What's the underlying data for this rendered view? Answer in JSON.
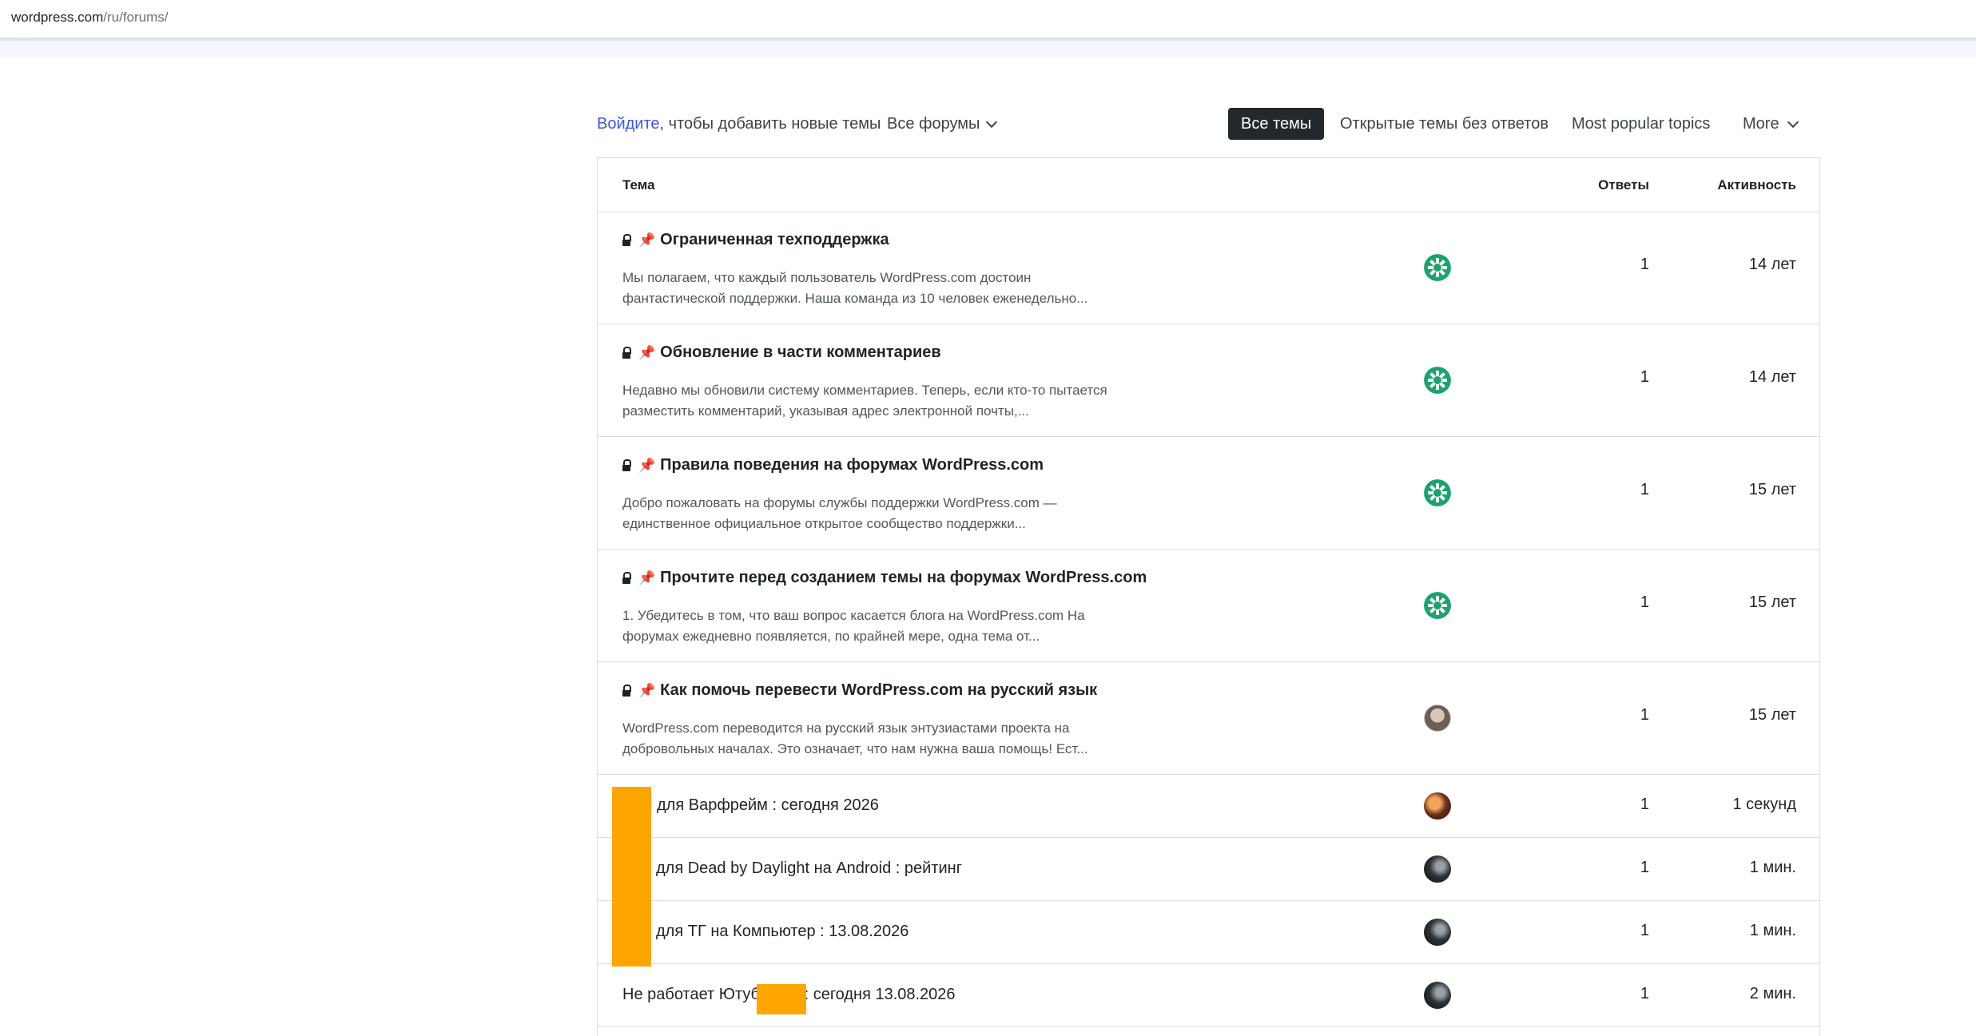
{
  "browser": {
    "url_host": "wordpress.com",
    "url_path": "/ru/forums/"
  },
  "toolbar": {
    "login_link": "Войдите",
    "login_rest": ", чтобы добавить новые темы",
    "forums_select": "Все форумы",
    "tabs": {
      "all": "Все темы",
      "open": "Открытые темы без ответов",
      "popular": "Most popular topics",
      "more": "More"
    }
  },
  "table": {
    "headers": {
      "topic": "Тема",
      "replies": "Ответы",
      "activity": "Активность"
    },
    "rows": [
      {
        "title": "Ограниченная техподдержка",
        "excerpt": "Мы полагаем, что каждый пользователь WordPress.com достоин фантастической поддержки. Наша команда из 10 человек еженедельно...",
        "avatar": "green-pattern-avatar",
        "replies": "1",
        "activity": "14 лет"
      },
      {
        "title": "Обновление в части комментариев",
        "excerpt": "Недавно мы обновили систему комментариев. Теперь, если кто-то пытается разместить комментарий, указывая адрес электронной почты,...",
        "avatar": "green-pattern-avatar",
        "replies": "1",
        "activity": "14 лет"
      },
      {
        "title": "Правила поведения на форумах WordPress.com",
        "excerpt": "Добро пожаловать на форумы службы поддержки WordPress.com — единственное официальное открытое сообщество поддержки...",
        "avatar": "green-pattern-avatar",
        "replies": "1",
        "activity": "15 лет"
      },
      {
        "title": "Прочтите перед созданием темы на форумах WordPress.com",
        "excerpt": "1. Убедитесь в том, что ваш вопрос касается блога на WordPress.com На форумах ежедневно появляется, по крайней мере, одна тема от...",
        "avatar": "green-pattern-avatar",
        "replies": "1",
        "activity": "15 лет"
      },
      {
        "title": "Как помочь перевести WordPress.com на русский язык",
        "excerpt": "WordPress.com переводится на русский язык энтузиастами проекта на добровольных началах. Это означает, что нам нужна ваша помощь! Ест...",
        "avatar": "photo-avatar",
        "replies": "1",
        "activity": "15 лет"
      },
      {
        "title": "l для Варфрейм : сегодня 2026",
        "avatar": "fire-avatar",
        "replies": "1",
        "activity": "1 секунд"
      },
      {
        "title": "для Dead by Daylight на Android : рейтинг",
        "avatar": "dark-avatar",
        "replies": "1",
        "activity": "1 мин."
      },
      {
        "title": "для ТГ на Компьютер : 13.08.2026",
        "avatar": "dark-avatar",
        "replies": "1",
        "activity": "1 мин."
      },
      {
        "title": "Не работает Ютуб          : сегодня 13.08.2026",
        "avatar": "dark-avatar",
        "replies": "1",
        "activity": "2 мин."
      }
    ]
  },
  "colors": {
    "link": "#3858e9",
    "active_tab_bg": "#23282d",
    "avatar_green": "#1aa36e",
    "redaction": "#ffa500"
  }
}
